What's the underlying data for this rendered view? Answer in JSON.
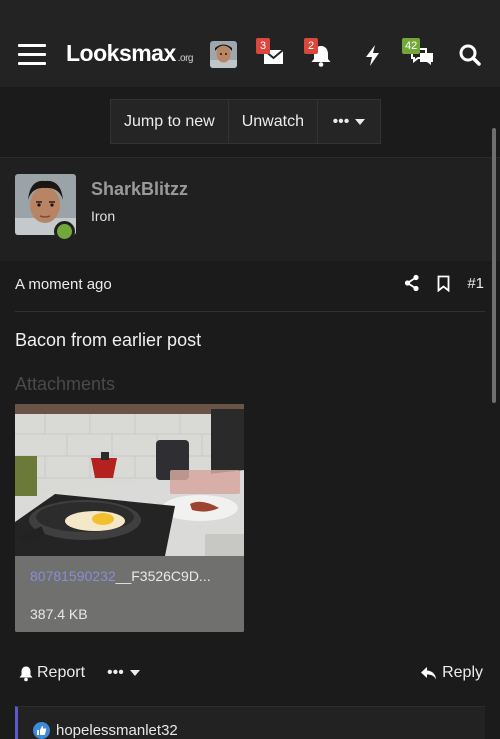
{
  "header": {
    "logo_text": "Looksmax",
    "logo_suffix": ".org",
    "conversations_badge": "3",
    "alerts_badge": "2",
    "new_posts_badge": "42",
    "icons": [
      "menu-icon",
      "avatar",
      "envelope-icon",
      "bell-icon",
      "bolt-icon",
      "chat-bubbles-icon",
      "search-icon"
    ]
  },
  "thread_actions": {
    "jump_to_new": "Jump to new",
    "unwatch": "Unwatch",
    "more": "•••"
  },
  "post": {
    "author": "SharkBlitzz",
    "user_title": "Iron",
    "timestamp": "A moment ago",
    "post_number": "#1",
    "body": "Bacon from earlier post",
    "attachments_label": "Attachments",
    "attachment": {
      "name_highlight": "80781590232",
      "name_rest": "__F3526C9D...",
      "size": "387.4 KB"
    }
  },
  "footer": {
    "report": "Report",
    "more": "•••",
    "reply": "Reply"
  },
  "reactions": {
    "user": "hopelessmanlet32"
  },
  "colors": {
    "background": "#1b1b1b",
    "header": "#232323",
    "badge_red": "#d9473f",
    "badge_green": "#72a83a",
    "online": "#72a83a",
    "reaction_accent": "#5a5acb",
    "like": "#3d8ad6"
  }
}
